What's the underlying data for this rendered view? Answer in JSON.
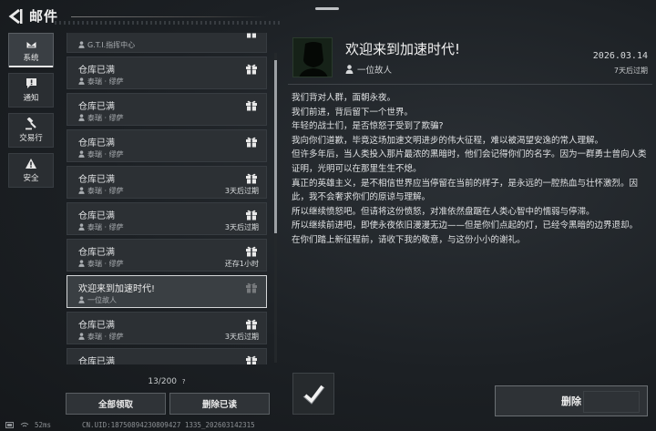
{
  "header": {
    "title": "邮件"
  },
  "sidebar": {
    "items": [
      {
        "label": "系统",
        "icon": "inbox-icon",
        "active": true
      },
      {
        "label": "通知",
        "icon": "message-icon",
        "active": false
      },
      {
        "label": "交易行",
        "icon": "gavel-icon",
        "active": false
      },
      {
        "label": "安全",
        "icon": "warning-icon",
        "active": false
      }
    ]
  },
  "mail_list": {
    "items": [
      {
        "title": "",
        "sender": "G.T.I.指挥中心",
        "expire": "",
        "gift": true,
        "active": false
      },
      {
        "title": "仓库已满",
        "sender": "泰瑞 · 缪萨",
        "expire": "",
        "gift": true,
        "active": false
      },
      {
        "title": "仓库已满",
        "sender": "泰瑞 · 缪萨",
        "expire": "",
        "gift": true,
        "active": false
      },
      {
        "title": "仓库已满",
        "sender": "泰瑞 · 缪萨",
        "expire": "",
        "gift": true,
        "active": false
      },
      {
        "title": "仓库已满",
        "sender": "泰瑞 · 缪萨",
        "expire": "3天后过期",
        "gift": true,
        "active": false
      },
      {
        "title": "仓库已满",
        "sender": "泰瑞 · 缪萨",
        "expire": "3天后过期",
        "gift": true,
        "active": false
      },
      {
        "title": "仓库已满",
        "sender": "泰瑞 · 缪萨",
        "expire": "还存1小时",
        "gift": true,
        "active": false
      },
      {
        "title": "欢迎来到加速时代!",
        "sender": "一位故人",
        "expire": "",
        "gift": true,
        "active": true
      },
      {
        "title": "仓库已满",
        "sender": "泰瑞 · 缪萨",
        "expire": "3天后过期",
        "gift": true,
        "active": false
      },
      {
        "title": "仓库已满",
        "sender": "泰瑞 · 缪萨",
        "expire": "",
        "gift": true,
        "active": false
      }
    ],
    "count": "13/200",
    "count_help": "?",
    "claim_all_label": "全部领取",
    "delete_read_label": "删除已读",
    "scroll_position": 0.05
  },
  "detail": {
    "title": "欢迎来到加速时代!",
    "sender": "一位故人",
    "date": "2026.03.14",
    "expire": "7天后过期",
    "body": [
      "我们背对人群，面朝永夜。",
      "我们前进，背后留下一个世界。",
      "年轻的战士们，是否惊怒于受到了欺骗?",
      "我向你们道歉，毕竟这场加速文明进步的伟大征程，难以被渴望安逸的常人理解。",
      "但许多年后，当人类投入那片最浓的黑暗时，他们会记得你们的名字。因为一群勇士曾向人类证明，光明可以在那里生生不熄。",
      "真正的英雄主义，是不相信世界应当停留在当前的样子，是永远的一腔热血与壮怀激烈。因此，我不会奢求你们的原谅与理解。",
      "所以继续愤怒吧。但请将这份愤怒，对准依然盘踞在人类心智中的懦弱与停滞。",
      "所以继续前进吧，即使永夜依旧漫漫无边——但是你们点起的灯，已经令黑暗的边界退却。",
      "在你们踏上新征程前，请收下我的敬意，与这份小小的谢礼。"
    ],
    "attachment_icon": "check-badge-icon",
    "delete_label": "删除"
  },
  "footer": {
    "latency": "52ms",
    "uid": "CN.UID:18750894230809427 1335_202603142315"
  },
  "colors": {
    "background": "#1c2024",
    "card": "#2c3034",
    "selected_border": "#d4d6d8"
  }
}
